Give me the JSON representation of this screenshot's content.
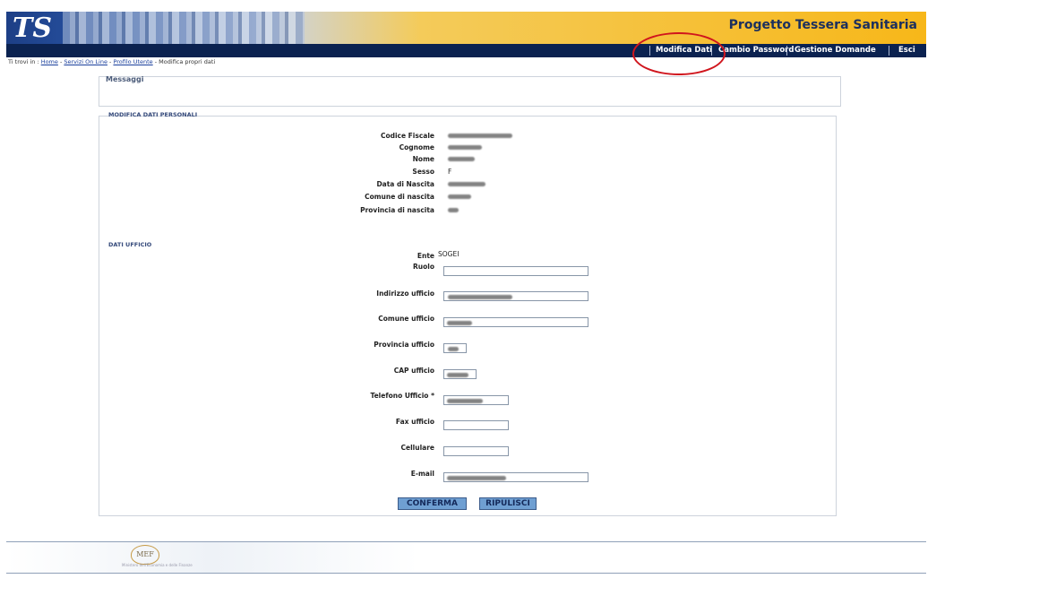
{
  "header": {
    "logo_text": "TS",
    "app_title": "Progetto Tessera Sanitaria",
    "nav": [
      "Modifica Dati",
      "Cambio Password",
      "Gestione Domande",
      "Esci"
    ]
  },
  "breadcrumb": {
    "prefix": "Ti trovi in :",
    "links": [
      "Home",
      "Servizi On Line",
      "Profilo Utente"
    ],
    "sep": " - ",
    "current": "Modifica propri dati"
  },
  "messages": {
    "label": "Messaggi"
  },
  "personal": {
    "title": "MODIFICA DATI PERSONALI",
    "rows": [
      {
        "label": "Codice Fiscale",
        "value": ""
      },
      {
        "label": "Cognome",
        "value": ""
      },
      {
        "label": "Nome",
        "value": ""
      },
      {
        "label": "Sesso",
        "value": "F"
      },
      {
        "label": "Data di Nascita",
        "value": ""
      },
      {
        "label": "Comune di nascita",
        "value": ""
      },
      {
        "label": "Provincia di nascita",
        "value": ""
      }
    ]
  },
  "office": {
    "title": "DATI UFFICIO",
    "ente_label": "Ente",
    "ente_value": "SOGEI",
    "fields": [
      {
        "label": "Ruolo",
        "value": ""
      },
      {
        "label": "Indirizzo ufficio",
        "value": ""
      },
      {
        "label": "Comune ufficio",
        "value": ""
      },
      {
        "label": "Provincia ufficio",
        "value": ""
      },
      {
        "label": "CAP ufficio",
        "value": ""
      },
      {
        "label": "Telefono Ufficio *",
        "value": ""
      },
      {
        "label": "Fax ufficio",
        "value": ""
      },
      {
        "label": "Cellulare",
        "value": ""
      },
      {
        "label": "E-mail",
        "value": ""
      }
    ]
  },
  "buttons": {
    "confirm": "CONFERMA",
    "reset": "RIPULISCI"
  },
  "footer": {
    "logo": "MEF",
    "subtitle": "Ministero dell'Economia e delle Finanze"
  },
  "colors": {
    "nav_bg": "#0b2250",
    "header_gold": "#f7b719",
    "annotation_circle": "#d0151d",
    "button": "#6f9fd2"
  }
}
